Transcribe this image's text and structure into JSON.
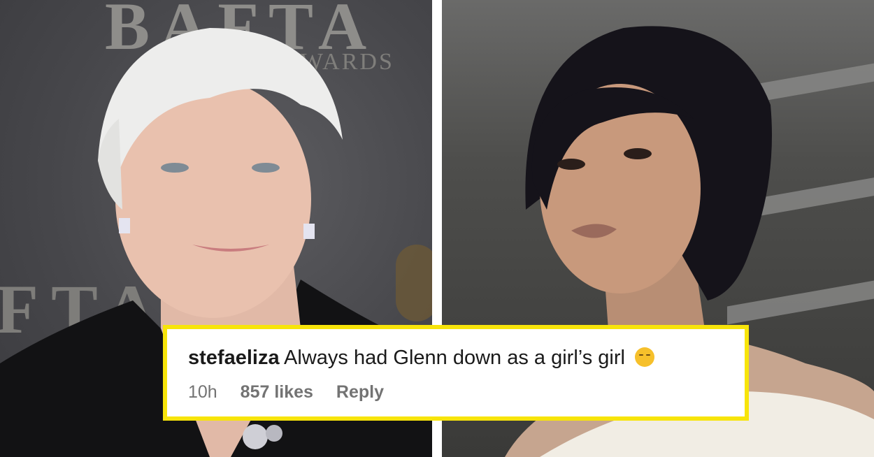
{
  "photo_left": {
    "background_lettering_top": "BAFTA",
    "background_lettering_sub": "AWARDS",
    "background_lettering_bottom": "FTA"
  },
  "comment": {
    "username": "stefaeliza",
    "text": "Always had Glenn down as a girl’s girl",
    "emoji": "relieved-face-emoji",
    "time": "10h",
    "likes": "857 likes",
    "reply_label": "Reply"
  },
  "colors": {
    "highlight_border": "#f7e40a",
    "meta_text": "#737373"
  }
}
